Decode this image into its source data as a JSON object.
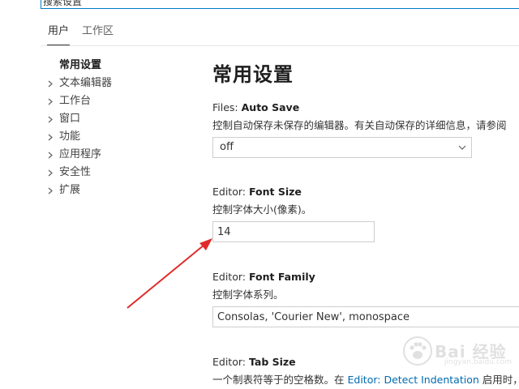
{
  "search": {
    "placeholder": "搜索设置"
  },
  "tabs": [
    {
      "label": "用户",
      "active": true
    },
    {
      "label": "工作区",
      "active": false
    }
  ],
  "toc": {
    "items": [
      {
        "label": "常用设置",
        "expandable": false,
        "active": true
      },
      {
        "label": "文本编辑器",
        "expandable": true
      },
      {
        "label": "工作台",
        "expandable": true
      },
      {
        "label": "窗口",
        "expandable": true
      },
      {
        "label": "功能",
        "expandable": true
      },
      {
        "label": "应用程序",
        "expandable": true
      },
      {
        "label": "安全性",
        "expandable": true
      },
      {
        "label": "扩展",
        "expandable": true
      }
    ],
    "chevron_icon": "chevron-right-icon"
  },
  "main": {
    "section_title": "常用设置",
    "settings": {
      "auto_save": {
        "category": "Files: ",
        "name": "Auto Save",
        "description": "控制自动保存未保存的编辑器。有关自动保存的详细信息，请参阅",
        "value": "off"
      },
      "font_size": {
        "category": "Editor: ",
        "name": "Font Size",
        "description": "控制字体大小(像素)。",
        "value": "14"
      },
      "font_family": {
        "category": "Editor: ",
        "name": "Font Family",
        "description": "控制字体系列。",
        "value": "Consolas, 'Courier New', monospace"
      },
      "tab_size": {
        "category": "Editor: ",
        "name": "Tab Size",
        "description_prefix": "一个制表符等于的空格数。在 ",
        "description_link": "Editor: Detect Indentation",
        "description_suffix": " 启用时，"
      }
    }
  },
  "annotation": {
    "arrow_color": "#e02a2a"
  },
  "watermark": {
    "text": "Bai 经验",
    "sub": "jingyan.baidu.com"
  },
  "colors": {
    "accent": "#007acc",
    "link": "#006ab1",
    "border": "#cecece"
  }
}
